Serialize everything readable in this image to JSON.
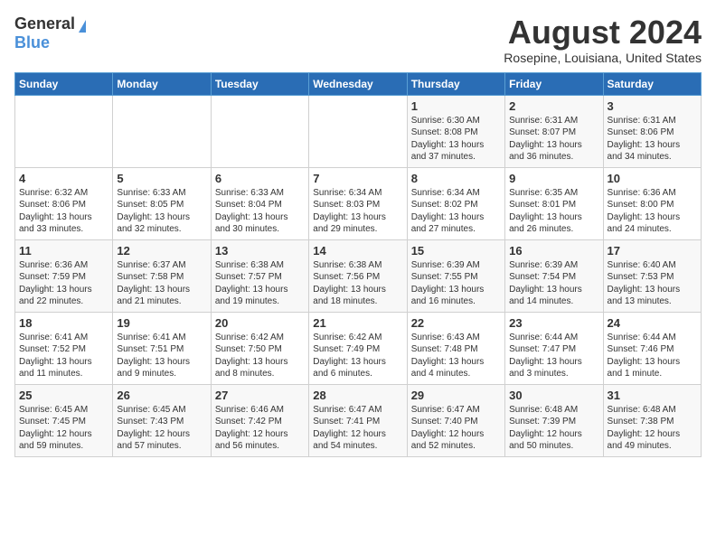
{
  "header": {
    "logo_general": "General",
    "logo_blue": "Blue",
    "month_year": "August 2024",
    "location": "Rosepine, Louisiana, United States"
  },
  "weekdays": [
    "Sunday",
    "Monday",
    "Tuesday",
    "Wednesday",
    "Thursday",
    "Friday",
    "Saturday"
  ],
  "weeks": [
    [
      {
        "day": "",
        "info": ""
      },
      {
        "day": "",
        "info": ""
      },
      {
        "day": "",
        "info": ""
      },
      {
        "day": "",
        "info": ""
      },
      {
        "day": "1",
        "info": "Sunrise: 6:30 AM\nSunset: 8:08 PM\nDaylight: 13 hours\nand 37 minutes."
      },
      {
        "day": "2",
        "info": "Sunrise: 6:31 AM\nSunset: 8:07 PM\nDaylight: 13 hours\nand 36 minutes."
      },
      {
        "day": "3",
        "info": "Sunrise: 6:31 AM\nSunset: 8:06 PM\nDaylight: 13 hours\nand 34 minutes."
      }
    ],
    [
      {
        "day": "4",
        "info": "Sunrise: 6:32 AM\nSunset: 8:06 PM\nDaylight: 13 hours\nand 33 minutes."
      },
      {
        "day": "5",
        "info": "Sunrise: 6:33 AM\nSunset: 8:05 PM\nDaylight: 13 hours\nand 32 minutes."
      },
      {
        "day": "6",
        "info": "Sunrise: 6:33 AM\nSunset: 8:04 PM\nDaylight: 13 hours\nand 30 minutes."
      },
      {
        "day": "7",
        "info": "Sunrise: 6:34 AM\nSunset: 8:03 PM\nDaylight: 13 hours\nand 29 minutes."
      },
      {
        "day": "8",
        "info": "Sunrise: 6:34 AM\nSunset: 8:02 PM\nDaylight: 13 hours\nand 27 minutes."
      },
      {
        "day": "9",
        "info": "Sunrise: 6:35 AM\nSunset: 8:01 PM\nDaylight: 13 hours\nand 26 minutes."
      },
      {
        "day": "10",
        "info": "Sunrise: 6:36 AM\nSunset: 8:00 PM\nDaylight: 13 hours\nand 24 minutes."
      }
    ],
    [
      {
        "day": "11",
        "info": "Sunrise: 6:36 AM\nSunset: 7:59 PM\nDaylight: 13 hours\nand 22 minutes."
      },
      {
        "day": "12",
        "info": "Sunrise: 6:37 AM\nSunset: 7:58 PM\nDaylight: 13 hours\nand 21 minutes."
      },
      {
        "day": "13",
        "info": "Sunrise: 6:38 AM\nSunset: 7:57 PM\nDaylight: 13 hours\nand 19 minutes."
      },
      {
        "day": "14",
        "info": "Sunrise: 6:38 AM\nSunset: 7:56 PM\nDaylight: 13 hours\nand 18 minutes."
      },
      {
        "day": "15",
        "info": "Sunrise: 6:39 AM\nSunset: 7:55 PM\nDaylight: 13 hours\nand 16 minutes."
      },
      {
        "day": "16",
        "info": "Sunrise: 6:39 AM\nSunset: 7:54 PM\nDaylight: 13 hours\nand 14 minutes."
      },
      {
        "day": "17",
        "info": "Sunrise: 6:40 AM\nSunset: 7:53 PM\nDaylight: 13 hours\nand 13 minutes."
      }
    ],
    [
      {
        "day": "18",
        "info": "Sunrise: 6:41 AM\nSunset: 7:52 PM\nDaylight: 13 hours\nand 11 minutes."
      },
      {
        "day": "19",
        "info": "Sunrise: 6:41 AM\nSunset: 7:51 PM\nDaylight: 13 hours\nand 9 minutes."
      },
      {
        "day": "20",
        "info": "Sunrise: 6:42 AM\nSunset: 7:50 PM\nDaylight: 13 hours\nand 8 minutes."
      },
      {
        "day": "21",
        "info": "Sunrise: 6:42 AM\nSunset: 7:49 PM\nDaylight: 13 hours\nand 6 minutes."
      },
      {
        "day": "22",
        "info": "Sunrise: 6:43 AM\nSunset: 7:48 PM\nDaylight: 13 hours\nand 4 minutes."
      },
      {
        "day": "23",
        "info": "Sunrise: 6:44 AM\nSunset: 7:47 PM\nDaylight: 13 hours\nand 3 minutes."
      },
      {
        "day": "24",
        "info": "Sunrise: 6:44 AM\nSunset: 7:46 PM\nDaylight: 13 hours\nand 1 minute."
      }
    ],
    [
      {
        "day": "25",
        "info": "Sunrise: 6:45 AM\nSunset: 7:45 PM\nDaylight: 12 hours\nand 59 minutes."
      },
      {
        "day": "26",
        "info": "Sunrise: 6:45 AM\nSunset: 7:43 PM\nDaylight: 12 hours\nand 57 minutes."
      },
      {
        "day": "27",
        "info": "Sunrise: 6:46 AM\nSunset: 7:42 PM\nDaylight: 12 hours\nand 56 minutes."
      },
      {
        "day": "28",
        "info": "Sunrise: 6:47 AM\nSunset: 7:41 PM\nDaylight: 12 hours\nand 54 minutes."
      },
      {
        "day": "29",
        "info": "Sunrise: 6:47 AM\nSunset: 7:40 PM\nDaylight: 12 hours\nand 52 minutes."
      },
      {
        "day": "30",
        "info": "Sunrise: 6:48 AM\nSunset: 7:39 PM\nDaylight: 12 hours\nand 50 minutes."
      },
      {
        "day": "31",
        "info": "Sunrise: 6:48 AM\nSunset: 7:38 PM\nDaylight: 12 hours\nand 49 minutes."
      }
    ]
  ]
}
